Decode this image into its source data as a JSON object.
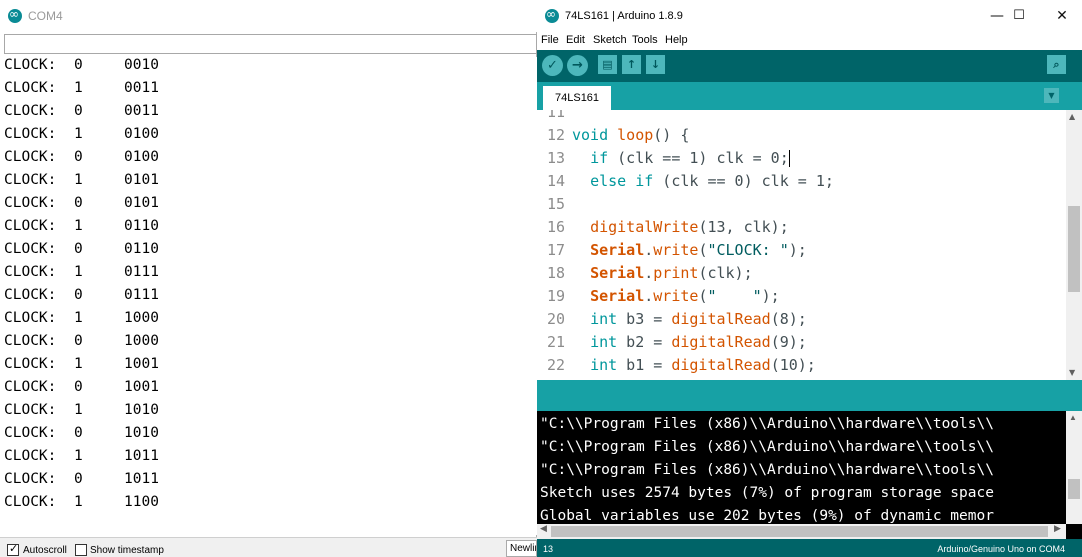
{
  "serial_monitor": {
    "title": "COM4",
    "send_input_value": "",
    "lines": [
      {
        "label": "CLOCK:",
        "clock": "0",
        "value": "0010"
      },
      {
        "label": "CLOCK:",
        "clock": "1",
        "value": "0011"
      },
      {
        "label": "CLOCK:",
        "clock": "0",
        "value": "0011"
      },
      {
        "label": "CLOCK:",
        "clock": "1",
        "value": "0100"
      },
      {
        "label": "CLOCK:",
        "clock": "0",
        "value": "0100"
      },
      {
        "label": "CLOCK:",
        "clock": "1",
        "value": "0101"
      },
      {
        "label": "CLOCK:",
        "clock": "0",
        "value": "0101"
      },
      {
        "label": "CLOCK:",
        "clock": "1",
        "value": "0110"
      },
      {
        "label": "CLOCK:",
        "clock": "0",
        "value": "0110"
      },
      {
        "label": "CLOCK:",
        "clock": "1",
        "value": "0111"
      },
      {
        "label": "CLOCK:",
        "clock": "0",
        "value": "0111"
      },
      {
        "label": "CLOCK:",
        "clock": "1",
        "value": "1000"
      },
      {
        "label": "CLOCK:",
        "clock": "0",
        "value": "1000"
      },
      {
        "label": "CLOCK:",
        "clock": "1",
        "value": "1001"
      },
      {
        "label": "CLOCK:",
        "clock": "0",
        "value": "1001"
      },
      {
        "label": "CLOCK:",
        "clock": "1",
        "value": "1010"
      },
      {
        "label": "CLOCK:",
        "clock": "0",
        "value": "1010"
      },
      {
        "label": "CLOCK:",
        "clock": "1",
        "value": "1011"
      },
      {
        "label": "CLOCK:",
        "clock": "0",
        "value": "1011"
      },
      {
        "label": "CLOCK:",
        "clock": "1",
        "value": "1100"
      }
    ],
    "autoscroll_label": "Autoscroll",
    "autoscroll_checked": true,
    "timestamp_label": "Show timestamp",
    "timestamp_checked": false,
    "line_ending": "Newlin"
  },
  "ide": {
    "title": "74LS161 | Arduino 1.8.9",
    "window_buttons": {
      "minimize": "—",
      "maximize": "☐",
      "close": "✕"
    },
    "menu": [
      "File",
      "Edit",
      "Sketch",
      "Tools",
      "Help"
    ],
    "toolbar": {
      "verify_icon": "check-icon",
      "upload_icon": "arrow-right-icon",
      "new_icon": "file-icon",
      "open_icon": "arrow-up-icon",
      "save_icon": "arrow-down-icon",
      "serial_monitor_icon": "magnifier-icon"
    },
    "tab_label": "74LS161",
    "code_lines": [
      {
        "num": "11",
        "text": ""
      },
      {
        "num": "12",
        "text": "void loop() {"
      },
      {
        "num": "13",
        "text": "  if (clk == 1) clk = 0;"
      },
      {
        "num": "14",
        "text": "  else if (clk == 0) clk = 1;"
      },
      {
        "num": "15",
        "text": ""
      },
      {
        "num": "16",
        "text": "  digitalWrite(13, clk);"
      },
      {
        "num": "17",
        "text": "  Serial.write(\"CLOCK: \");"
      },
      {
        "num": "18",
        "text": "  Serial.print(clk);"
      },
      {
        "num": "19",
        "text": "  Serial.write(\"    \");"
      },
      {
        "num": "20",
        "text": "  int b3 = digitalRead(8);"
      },
      {
        "num": "21",
        "text": "  int b2 = digitalRead(9);"
      },
      {
        "num": "22",
        "text": "  int b1 = digitalRead(10);"
      }
    ],
    "console_lines": [
      "\"C:\\\\Program Files (x86)\\\\Arduino\\\\hardware\\\\tools\\\\",
      "\"C:\\\\Program Files (x86)\\\\Arduino\\\\hardware\\\\tools\\\\",
      "\"C:\\\\Program Files (x86)\\\\Arduino\\\\hardware\\\\tools\\\\",
      "Sketch uses 2574 bytes (7%) of program storage space",
      "Global variables use 202 bytes (9%) of dynamic memor"
    ],
    "footer": {
      "line_number": "13",
      "board": "Arduino/Genuino Uno on COM4"
    }
  },
  "colors": {
    "arduino_dark_teal": "#006468",
    "arduino_teal": "#17a1a5",
    "arduino_button": "#4db7bb",
    "keyword": "#00979c",
    "function": "#d35400",
    "console_bg": "#000000"
  }
}
